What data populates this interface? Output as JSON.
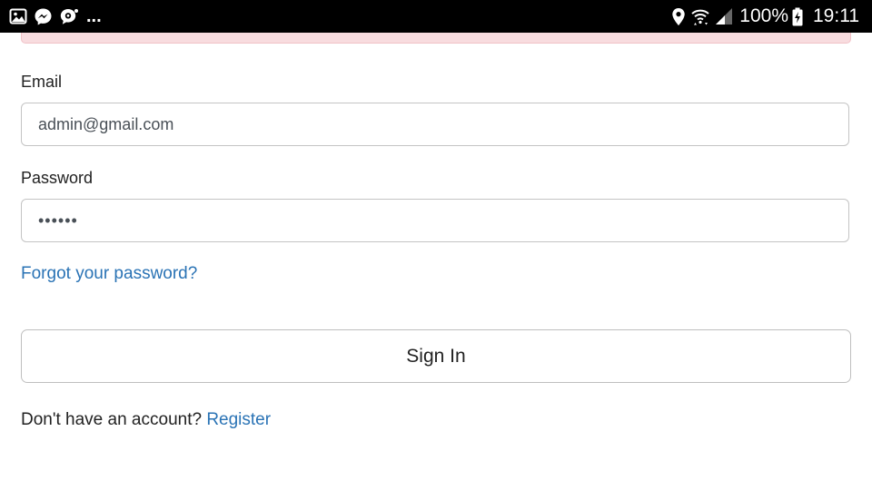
{
  "status_bar": {
    "left_icons": [
      "image-icon",
      "messenger-icon",
      "chat-bubble-icon"
    ],
    "overflow": "...",
    "right_icons": [
      "location-icon",
      "wifi-icon",
      "signal-icon"
    ],
    "battery_percent": "100%",
    "battery_icon": "battery-charging-icon",
    "time": "19:11"
  },
  "form": {
    "email_label": "Email",
    "email_value": "admin@gmail.com",
    "password_label": "Password",
    "password_value": "••••••",
    "forgot_link": "Forgot your password?",
    "submit_label": "Sign In",
    "register_prompt": "Don't have an account?",
    "register_link": "Register"
  },
  "colors": {
    "link": "#2a73b5",
    "alert_bg": "#f8dcdf",
    "alert_border": "#f1c2c7",
    "input_border": "#c4c4c4",
    "status_bar": "#000000"
  }
}
